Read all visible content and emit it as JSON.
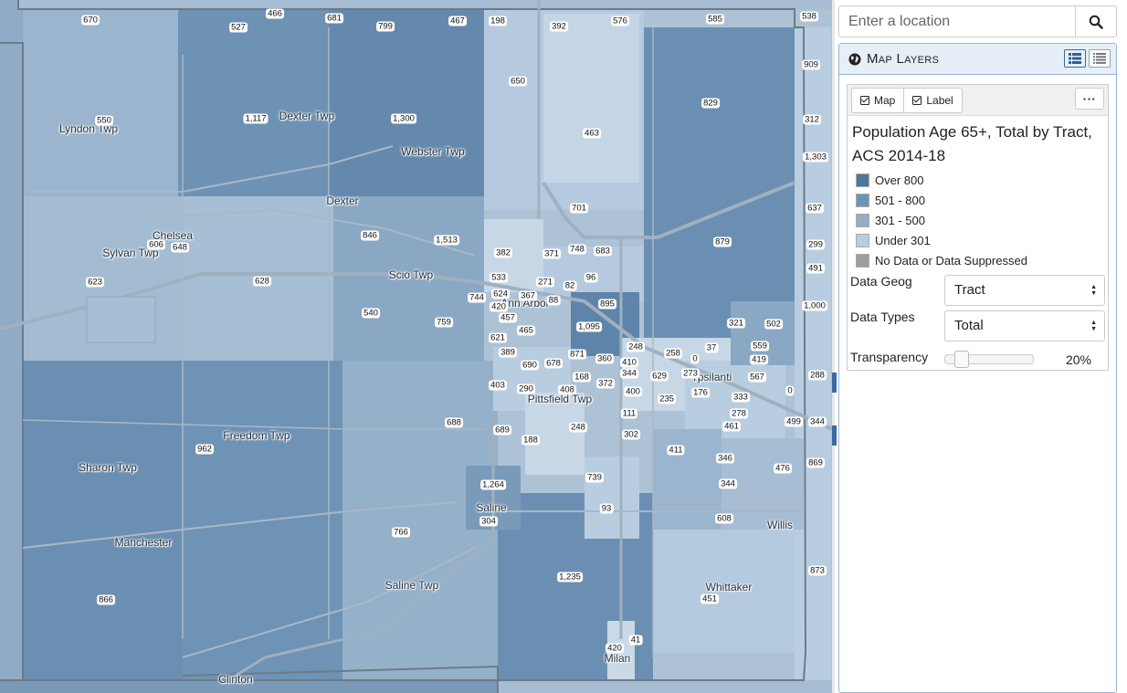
{
  "search": {
    "placeholder": "Enter a location"
  },
  "layers_panel": {
    "title": "Map Layers",
    "view_icons": [
      "detailed-list-icon",
      "compact-list-icon"
    ]
  },
  "layer": {
    "toggle_map": "Map",
    "toggle_label": "Label",
    "more": "···",
    "title": "Population Age 65+, Total by Tract, ACS 2014-18",
    "legend": [
      {
        "label": "Over 800",
        "color": "#4f779b"
      },
      {
        "label": "501 - 800",
        "color": "#6f93b5"
      },
      {
        "label": "301 - 500",
        "color": "#93afc8"
      },
      {
        "label": "Under 301",
        "color": "#b8cde0"
      },
      {
        "label": "No Data or Data Suppressed",
        "color": "#9e9e9e"
      }
    ],
    "data_geog_label": "Data Geog",
    "data_geog_value": "Tract",
    "data_types_label": "Data Types",
    "data_types_value": "Total",
    "transparency_label": "Transparency",
    "transparency_value": "20%",
    "transparency_fraction": 0.2
  },
  "map": {
    "places": [
      "Lyndon Twp",
      "Dexter Twp",
      "Webster Twp",
      "Dexter",
      "Chelsea",
      "Sylvan Twp",
      "Scio Twp",
      "Ann Arbor",
      "Freedom Twp",
      "Sharon Twp",
      "Manchester",
      "Saline",
      "Saline Twp",
      "Pittsfield Twp",
      "Ypsilanti",
      "Whittaker",
      "Willis",
      "Milan",
      "Clinton"
    ],
    "values": [
      "670",
      "466",
      "527",
      "681",
      "799",
      "467",
      "198",
      "576",
      "392",
      "585",
      "538",
      "650",
      "909",
      "550",
      "1,117",
      "1,300",
      "829",
      "463",
      "312",
      "1,303",
      "701",
      "637",
      "846",
      "1,513",
      "879",
      "606",
      "648",
      "382",
      "371",
      "748",
      "683",
      "299",
      "533",
      "96",
      "491",
      "623",
      "628",
      "271",
      "82",
      "624",
      "744",
      "367",
      "895",
      "88",
      "420",
      "1,000",
      "540",
      "457",
      "759",
      "1,095",
      "465",
      "321",
      "502",
      "621",
      "248",
      "37",
      "559",
      "389",
      "871",
      "258",
      "0",
      "419",
      "690",
      "678",
      "360",
      "410",
      "273",
      "567",
      "288",
      "344",
      "629",
      "168",
      "403",
      "290",
      "408",
      "372",
      "400",
      "176",
      "235",
      "333",
      "0",
      "111",
      "278",
      "688",
      "499",
      "344",
      "689",
      "248",
      "461",
      "962",
      "302",
      "188",
      "411",
      "346",
      "869",
      "476",
      "739",
      "1,264",
      "344",
      "93",
      "304",
      "608",
      "766",
      "1,235",
      "873",
      "866",
      "451",
      "420",
      "41"
    ]
  }
}
